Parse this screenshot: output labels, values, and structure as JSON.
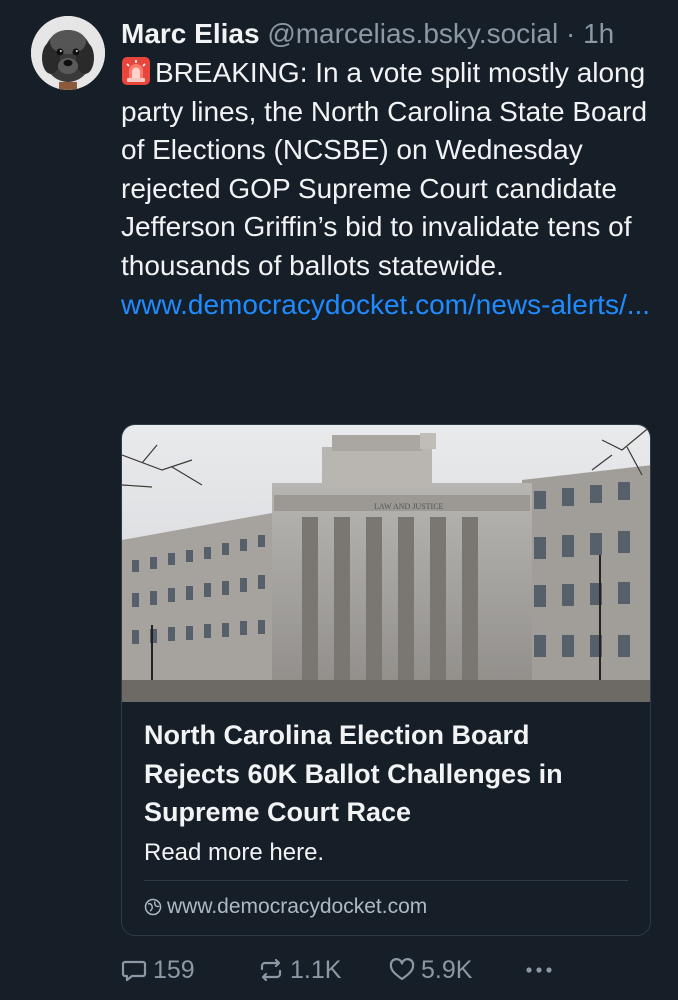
{
  "post": {
    "author_name": "Marc Elias",
    "author_handle": "@marcelias.bsky.social",
    "separator": "·",
    "time": "1h",
    "text": "BREAKING: In a vote split mostly along party lines, the North Carolina State Board of Elections (NCSBE) on Wednesday rejected GOP Supreme Court candidate Jefferson Griffin’s bid to invalidate tens of thousands of ballots statewide.",
    "link_text": "www.democracydocket.com/news-alerts/...",
    "emoji_icon": "police-siren-icon"
  },
  "card": {
    "title": "North Carolina Election Board Rejects 60K Ballot Challenges in Supreme Court Race",
    "description": "Read more here.",
    "domain": "www.democracydocket.com",
    "image_text": "LAW AND JUSTICE"
  },
  "actions": {
    "replies": "159",
    "reposts": "1.1K",
    "likes": "5.9K"
  },
  "colors": {
    "background": "#161e27",
    "link": "#208bfe",
    "muted": "#8b98a5",
    "border": "#2e3b48"
  }
}
